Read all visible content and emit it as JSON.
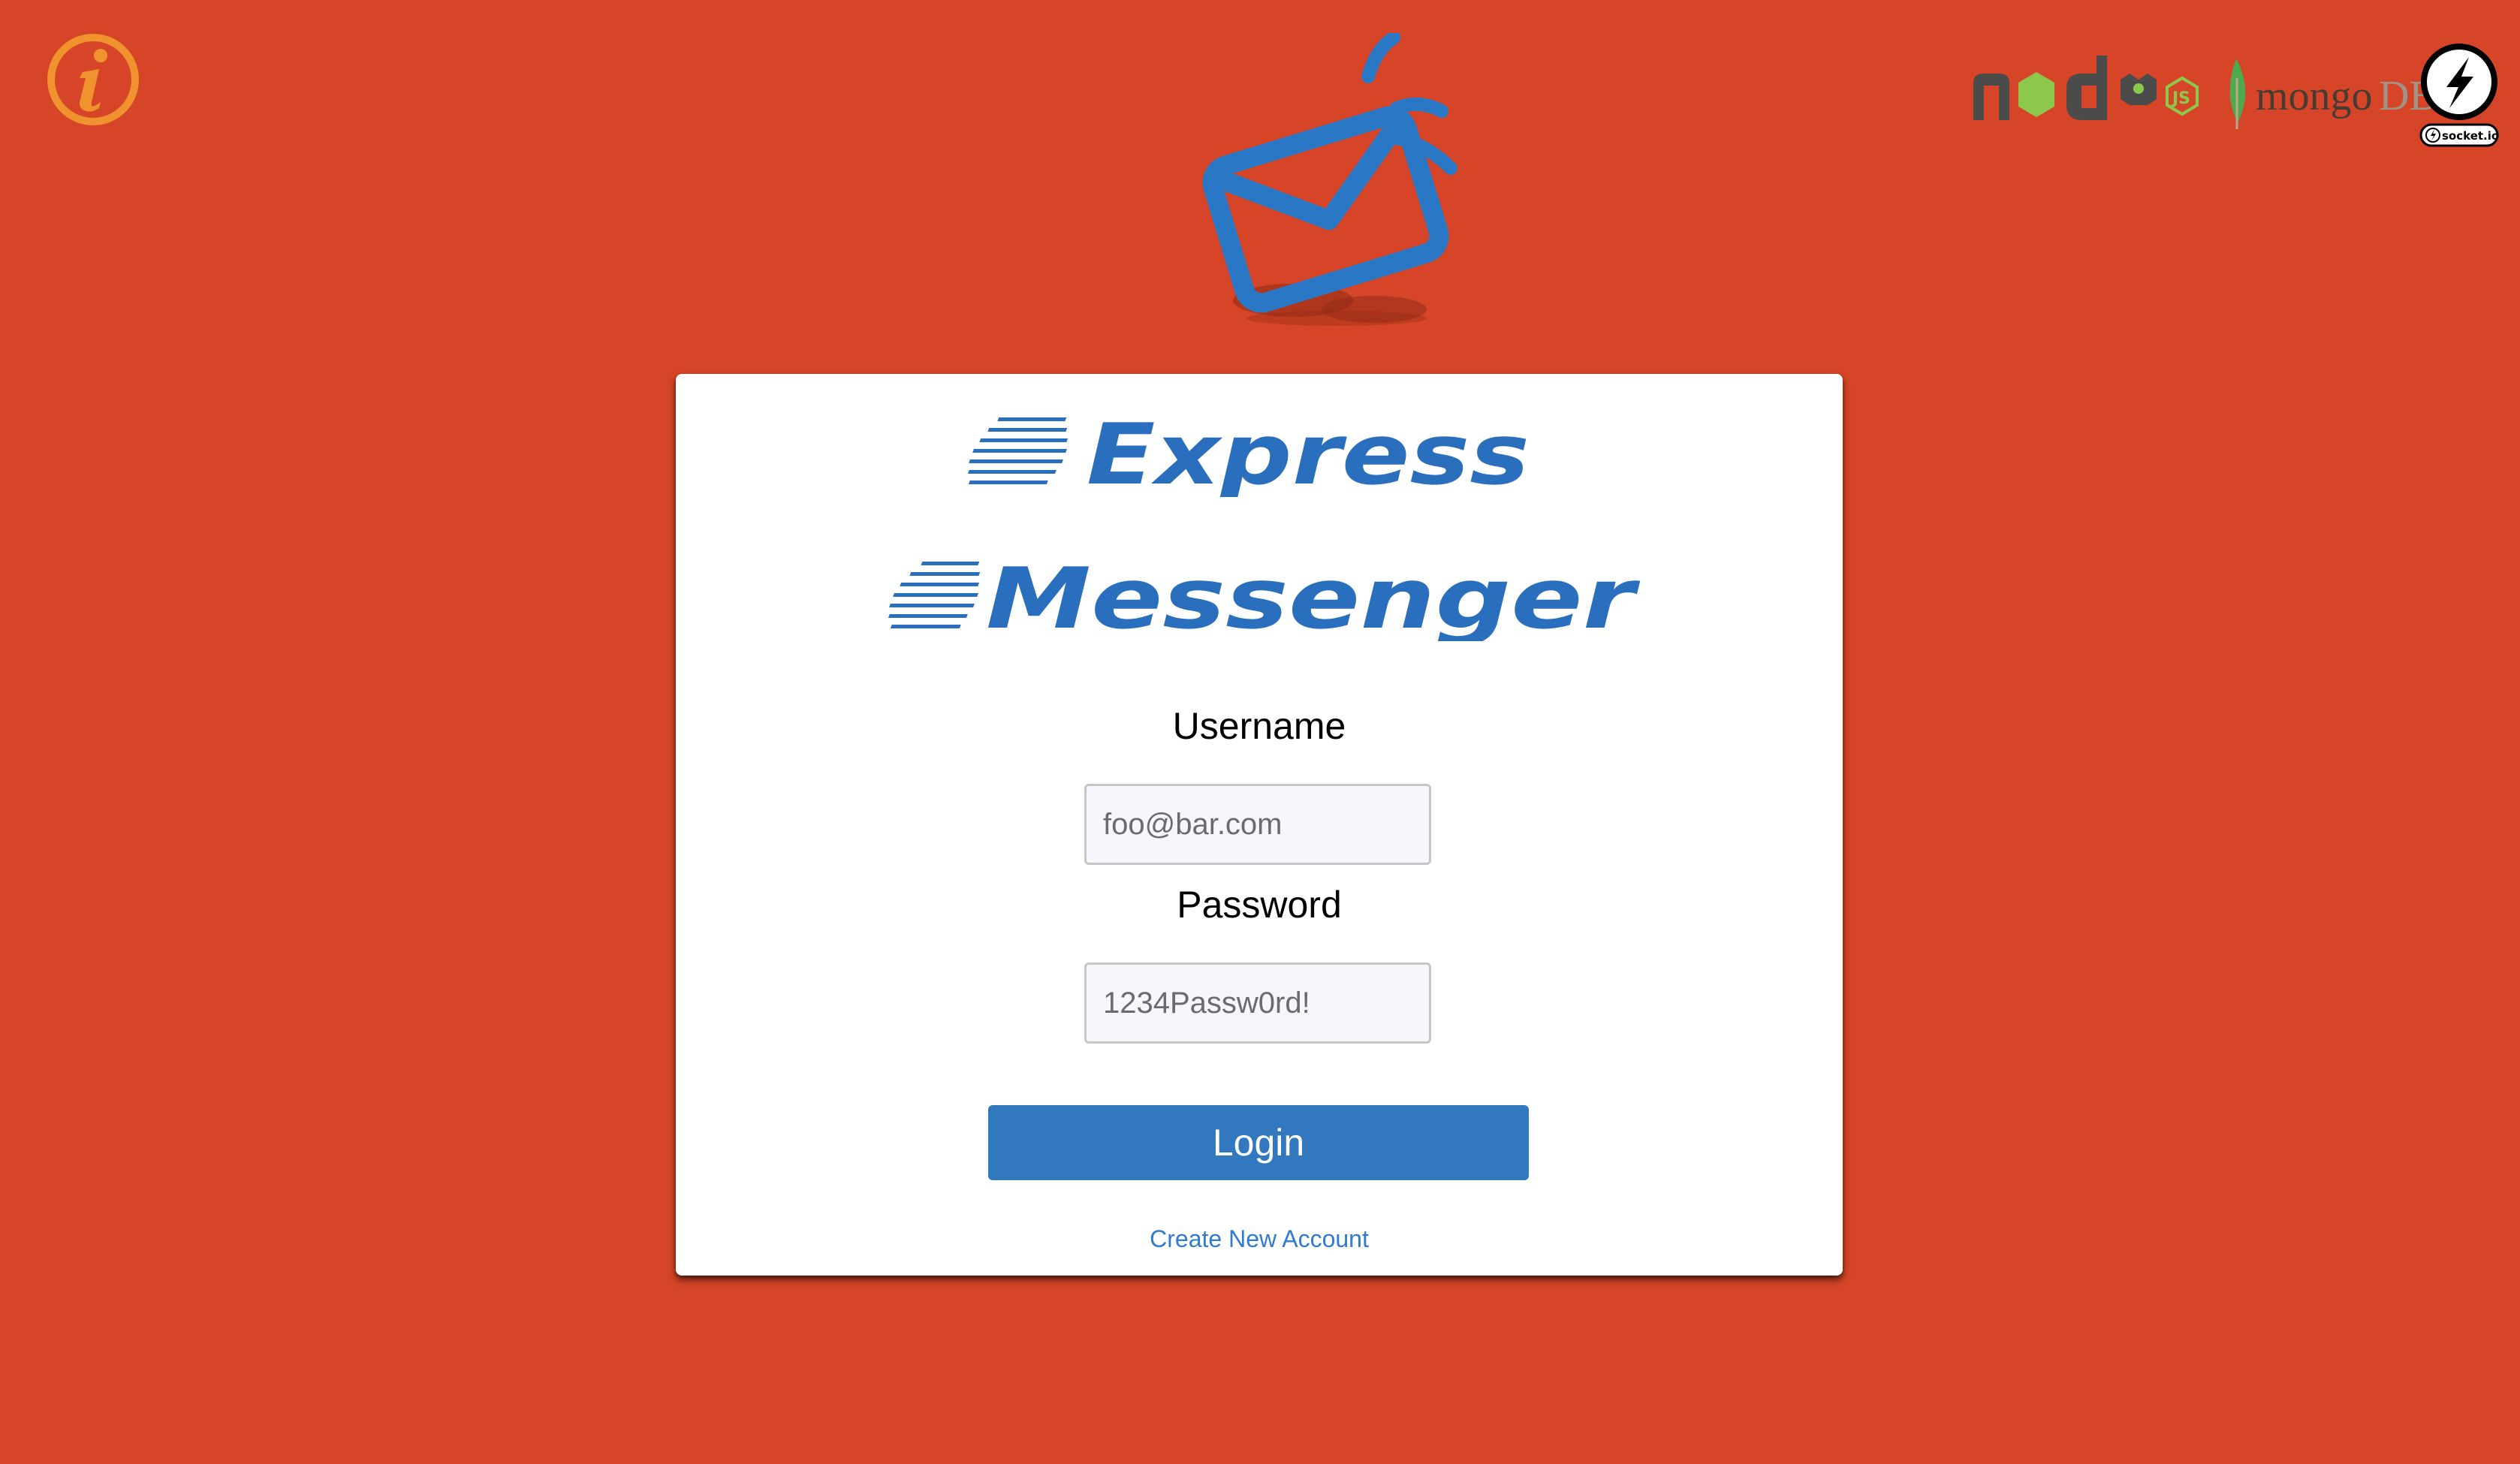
{
  "header": {
    "info_icon": "info-circle-icon",
    "envelope_icon": "envelope-icon",
    "tech_logos": [
      {
        "name": "node-logo",
        "text": "node"
      },
      {
        "name": "mongodb-logo",
        "text_main": "mongo",
        "text_suffix": "DB"
      },
      {
        "name": "socketio-logo",
        "text": "socket.io"
      }
    ]
  },
  "card": {
    "title_line1": "Express",
    "title_line2": "Messenger",
    "username": {
      "label": "Username",
      "placeholder": "foo@bar.com"
    },
    "password": {
      "label": "Password",
      "placeholder": "1234Passw0rd!"
    },
    "login_label": "Login",
    "create_account_label": "Create New Account"
  },
  "colors": {
    "background": "#d64527",
    "accent": "#2a6fbd",
    "button": "#3178bf",
    "link": "#2f7bd0",
    "info_icon": "#f0922e",
    "node_green": "#8cc84b",
    "mongo_leaf": "#4fa94d"
  }
}
